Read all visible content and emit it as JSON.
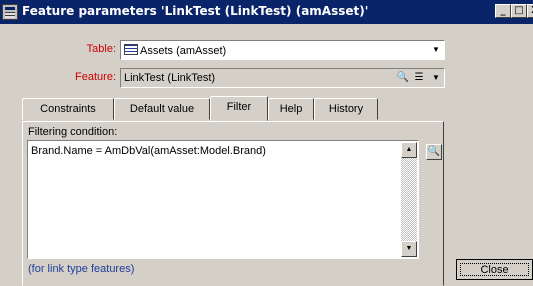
{
  "window": {
    "title": "Feature parameters 'LinkTest (LinkTest) (amAsset)'",
    "minimize": "_",
    "maximize": "□",
    "close": "X"
  },
  "form": {
    "table_label": "Table:",
    "table_value": "Assets (amAsset)",
    "feature_label": "Feature:",
    "feature_value": "LinkTest (LinkTest)"
  },
  "tabs": [
    "Constraints",
    "Default value",
    "Filter",
    "Help",
    "History"
  ],
  "active_tab": "Filter",
  "filter": {
    "label": "Filtering condition:",
    "value": "Brand.Name = AmDbVal(amAsset:Model.Brand)"
  },
  "footer_note": "(for link type features)",
  "buttons": {
    "close": "Close"
  },
  "icons": {
    "search": "🔍",
    "list": "☰",
    "dropdown": "▼",
    "scroll_up": "▲",
    "scroll_down": "▼"
  }
}
